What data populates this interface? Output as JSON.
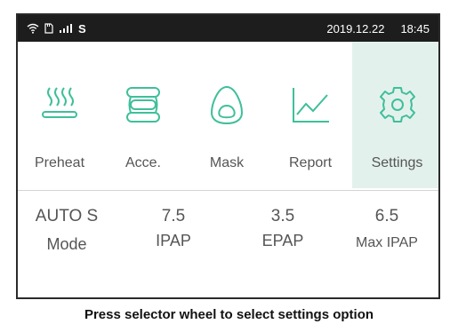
{
  "status_bar": {
    "icons": [
      "wifi-icon",
      "sd-card-icon",
      "signal-icon"
    ],
    "letter": "S",
    "date": "2019.12.22",
    "time": "18:45"
  },
  "menu": {
    "items": [
      {
        "label": "Preheat",
        "icon": "heat-waves-icon",
        "selected": false
      },
      {
        "label": "Acce.",
        "icon": "accessory-icon",
        "selected": false
      },
      {
        "label": "Mask",
        "icon": "mask-icon",
        "selected": false
      },
      {
        "label": "Report",
        "icon": "line-chart-icon",
        "selected": false
      },
      {
        "label": "Settings",
        "icon": "gear-icon",
        "selected": true
      }
    ]
  },
  "params": {
    "mode": {
      "value": "AUTO S",
      "label": "Mode"
    },
    "ipap": {
      "value": "7.5",
      "label": "IPAP"
    },
    "epap": {
      "value": "3.5",
      "label": "EPAP"
    },
    "max_ipap": {
      "value": "6.5",
      "label": "Max IPAP"
    }
  },
  "caption": "Press selector wheel to select settings option",
  "colors": {
    "accent": "#3fbf9a",
    "selected_bg": "#e3f1ec",
    "status_bar_bg": "#1d1d1d",
    "text": "#555555"
  }
}
